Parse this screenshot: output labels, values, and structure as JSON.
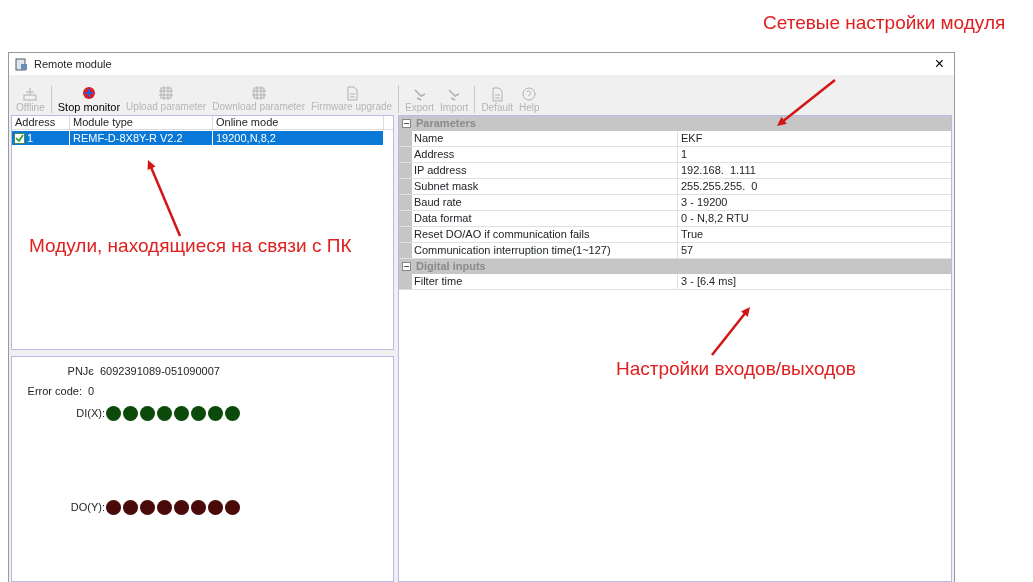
{
  "window": {
    "title": "Remote module",
    "close": "×"
  },
  "toolbar": [
    [
      {
        "label": "Offline",
        "disabled": true
      }
    ],
    [
      {
        "label": "Stop monitor",
        "disabled": false
      },
      {
        "label": "Upload parameter",
        "disabled": true
      },
      {
        "label": "Download parameter",
        "disabled": true
      },
      {
        "label": "Firmware upgrade",
        "disabled": true
      }
    ],
    [
      {
        "label": "Export",
        "disabled": true
      },
      {
        "label": "Import",
        "disabled": true
      }
    ],
    [
      {
        "label": "Default",
        "disabled": true
      },
      {
        "label": "Help",
        "disabled": true
      }
    ]
  ],
  "modules": {
    "columns": [
      "Address",
      "Module type",
      "Online mode"
    ],
    "rows": [
      {
        "checked": true,
        "selected": true,
        "cells": [
          "1",
          "REMF-D-8X8Y-R V2.2",
          "19200,N,8,2"
        ]
      }
    ]
  },
  "status": {
    "serial_label": "PNJє",
    "serial": "6092391089-051090007",
    "error_label": "Error code:",
    "error": "0",
    "io": [
      {
        "label": "DI(X):",
        "leds": [
          {
            "color": "#0b4a0b"
          },
          {
            "color": "#0b4a0b"
          },
          {
            "color": "#0b4a0b"
          },
          {
            "color": "#0b4a0b"
          },
          {
            "color": "#0b4a0b"
          },
          {
            "color": "#0b4a0b"
          },
          {
            "color": "#0b4a0b"
          },
          {
            "color": "#0b4a0b"
          }
        ]
      },
      {
        "label": "DO(Y):",
        "leds": [
          {
            "color": "#4a0a0a"
          },
          {
            "color": "#4a0a0a"
          },
          {
            "color": "#4a0a0a"
          },
          {
            "color": "#4a0a0a"
          },
          {
            "color": "#4a0a0a"
          },
          {
            "color": "#4a0a0a"
          },
          {
            "color": "#4a0a0a"
          },
          {
            "color": "#4a0a0a"
          }
        ]
      }
    ]
  },
  "properties": [
    {
      "category": "Parameters",
      "expanded": true,
      "rows": [
        {
          "name": "Name",
          "value": "EKF"
        },
        {
          "name": "Address",
          "value": "1"
        },
        {
          "name": "IP address",
          "value": "192.168.  1.111"
        },
        {
          "name": "Subnet mask",
          "value": "255.255.255.  0"
        },
        {
          "name": "Baud rate",
          "value": "3 - 19200"
        },
        {
          "name": "Data format",
          "value": "0 - N,8,2 RTU"
        },
        {
          "name": "Reset DO/AO if communication fails",
          "value": "True"
        },
        {
          "name": "Communication interruption time(1~127)",
          "value": "57"
        }
      ]
    },
    {
      "category": "Digital inputs",
      "expanded": true,
      "rows": [
        {
          "name": "Filter time",
          "value": "3 - [6.4 ms]"
        }
      ]
    }
  ],
  "annotations": [
    {
      "text": "Сетевые настройки модуля"
    },
    {
      "text": "Модули, находящиеся на связи с ПК"
    },
    {
      "text": "Настройки входов/выходов"
    }
  ]
}
